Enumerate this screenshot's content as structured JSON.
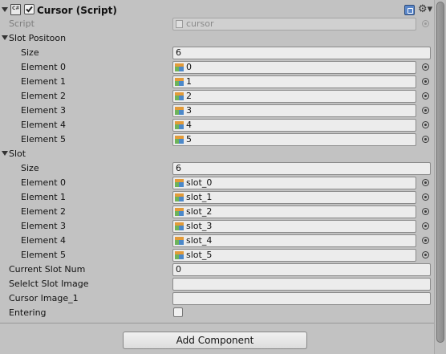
{
  "component": {
    "title": "Cursor (Script)",
    "enabled": true,
    "script_label": "Script",
    "script_value": "cursor"
  },
  "slot_position": {
    "label": "Slot Positoon",
    "size_label": "Size",
    "size_value": "6",
    "elements": [
      {
        "label": "Element 0",
        "value": "0"
      },
      {
        "label": "Element 1",
        "value": "1"
      },
      {
        "label": "Element 2",
        "value": "2"
      },
      {
        "label": "Element 3",
        "value": "3"
      },
      {
        "label": "Element 4",
        "value": "4"
      },
      {
        "label": "Element 5",
        "value": "5"
      }
    ]
  },
  "slot": {
    "label": "Slot",
    "size_label": "Size",
    "size_value": "6",
    "elements": [
      {
        "label": "Element 0",
        "value": "slot_0"
      },
      {
        "label": "Element 1",
        "value": "slot_1"
      },
      {
        "label": "Element 2",
        "value": "slot_2"
      },
      {
        "label": "Element 3",
        "value": "slot_3"
      },
      {
        "label": "Element 4",
        "value": "slot_4"
      },
      {
        "label": "Element 5",
        "value": "slot_5"
      }
    ]
  },
  "fields": {
    "current_slot_num_label": "Current Slot Num",
    "current_slot_num_value": "0",
    "select_slot_image_label": "Selelct Slot Image",
    "select_slot_image_value": "",
    "cursor_image_label": "Cursor Image_1",
    "cursor_image_value": "",
    "entering_label": "Entering",
    "entering_checked": false
  },
  "add_component_label": "Add Component",
  "icons": {
    "fold": "fold-arrow-icon",
    "script": "script-icon",
    "help": "help-book-icon",
    "gear": "gear-icon",
    "object": "gameobject-cube-icon",
    "picker": "object-picker-icon"
  }
}
